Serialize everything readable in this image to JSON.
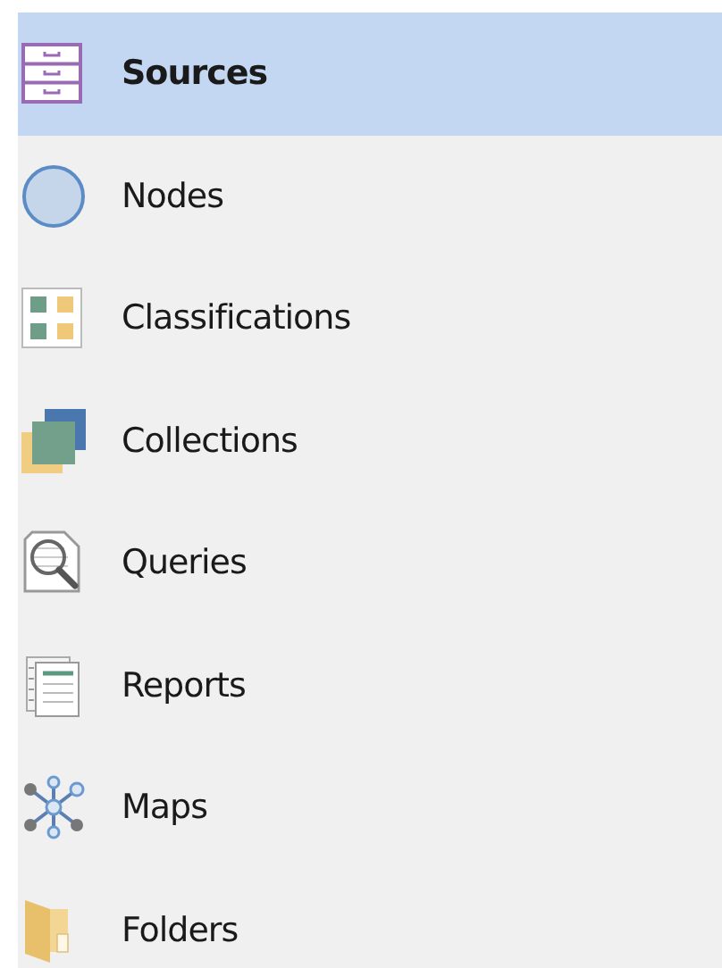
{
  "navigation": {
    "items": [
      {
        "kind": "sources",
        "label": "Sources",
        "selected": true
      },
      {
        "kind": "nodes",
        "label": "Nodes",
        "selected": false
      },
      {
        "kind": "classifications",
        "label": "Classifications",
        "selected": false
      },
      {
        "kind": "collections",
        "label": "Collections",
        "selected": false
      },
      {
        "kind": "queries",
        "label": "Queries",
        "selected": false
      },
      {
        "kind": "reports",
        "label": "Reports",
        "selected": false
      },
      {
        "kind": "maps",
        "label": "Maps",
        "selected": false
      },
      {
        "kind": "folders",
        "label": "Folders",
        "selected": false
      }
    ]
  }
}
